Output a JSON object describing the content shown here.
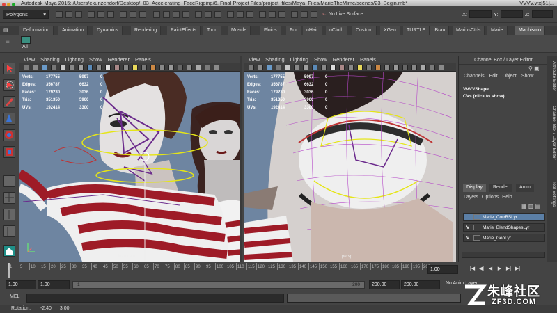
{
  "app": {
    "title": "Autodesk Maya 2015: /Users/ekunzendorf/Desktop/_03_Accelerating_FaceRigging/6. Final Project Files/project_files/Maya_Files/MarieTheMime/scenes/23_Begin.mb*",
    "title_right": "VVVV.vtx[51]..."
  },
  "status_line": {
    "menu_set": "Polygons",
    "live_surface": "No Live Surface",
    "x_label": "X:",
    "y_label": "Y:",
    "z_label": "Z:"
  },
  "shelf": {
    "tabs": [
      "Deformation",
      "Animation",
      "Dynamics",
      "Rendering",
      "PaintEffects",
      "Toon",
      "Muscle",
      "Fluids",
      "Fur",
      "nHair",
      "nCloth",
      "Custom",
      "XGen",
      "TURTLE",
      "iBrau",
      "MariusCtrls",
      "Marie",
      "Machismo"
    ],
    "active_tab": "Machismo",
    "shelf_button": "All"
  },
  "viewport_menu": [
    "View",
    "Shading",
    "Lighting",
    "Show",
    "Renderer",
    "Panels"
  ],
  "viewport_left": {
    "hud": [
      {
        "label": "Verts:",
        "v1": "177755",
        "v2": "5997",
        "v3": "0"
      },
      {
        "label": "Edges:",
        "v1": "356787",
        "v2": "6632",
        "v3": "0"
      },
      {
        "label": "Faces:",
        "v1": "179230",
        "v2": "3036",
        "v3": "0"
      },
      {
        "label": "Tris:",
        "v1": "351350",
        "v2": "5960",
        "v3": "0"
      },
      {
        "label": "UVs:",
        "v1": "192414",
        "v2": "3300",
        "v3": "0"
      }
    ],
    "camera": "Tempcam"
  },
  "viewport_right": {
    "hud": [
      {
        "label": "Verts:",
        "v1": "177755",
        "v2": "5997",
        "v3": "0"
      },
      {
        "label": "Edges:",
        "v1": "356787",
        "v2": "6632",
        "v3": "0"
      },
      {
        "label": "Faces:",
        "v1": "179230",
        "v2": "3036",
        "v3": "0"
      },
      {
        "label": "Tris:",
        "v1": "351350",
        "v2": "5960",
        "v3": "0"
      },
      {
        "label": "UVs:",
        "v1": "192414",
        "v2": "3300",
        "v3": "0"
      }
    ],
    "camera": "persp"
  },
  "channel_box": {
    "header": "Channel Box / Layer Editor",
    "menu": [
      "Channels",
      "Edit",
      "Object",
      "Show"
    ],
    "object_name": "VVVVShape",
    "object_sub": "CVs (click to show)"
  },
  "layer_editor": {
    "tabs": [
      "Display",
      "Render",
      "Anim"
    ],
    "active_tab": "Display",
    "menu": [
      "Layers",
      "Options",
      "Help"
    ],
    "layers": [
      {
        "v": "",
        "name": "Marie_CorrBSLyr",
        "selected": true
      },
      {
        "v": "V",
        "name": "Marie_BlendShapesLyr",
        "selected": false
      },
      {
        "v": "V",
        "name": "Marie_GeoLyr",
        "selected": false
      }
    ]
  },
  "side_tabs": [
    "Attribute Editor",
    "Channel Box / Layer Editor",
    "Tool Settings"
  ],
  "time_slider": {
    "ticks": [
      "1",
      "5",
      "10",
      "15",
      "20",
      "25",
      "30",
      "35",
      "40",
      "45",
      "50",
      "55",
      "60",
      "65",
      "70",
      "75",
      "80",
      "85",
      "90",
      "95",
      "100",
      "105",
      "110",
      "115",
      "120",
      "125",
      "130",
      "135",
      "140",
      "145",
      "150",
      "155",
      "160",
      "165",
      "170",
      "175",
      "180",
      "185",
      "190",
      "195",
      "200"
    ],
    "current_frame": "1.00"
  },
  "playback": [
    "|◀",
    "◀|",
    "◀",
    "▶",
    "▶|",
    "▶|"
  ],
  "range_slider": {
    "start": "1.00",
    "anim_start": "1.00",
    "range_left": "1",
    "range_right": "200",
    "anim_end": "200.00",
    "end": "200.00",
    "anim_layer": "No Anim Layer"
  },
  "command_line": {
    "label": "MEL"
  },
  "help_line": {
    "rotation_label": "Rotation:",
    "rotation_x": "-2.40",
    "rotation_y": "3.00"
  },
  "watermark": {
    "line1": "朱峰社区",
    "line2": "ZF3D.COM"
  }
}
